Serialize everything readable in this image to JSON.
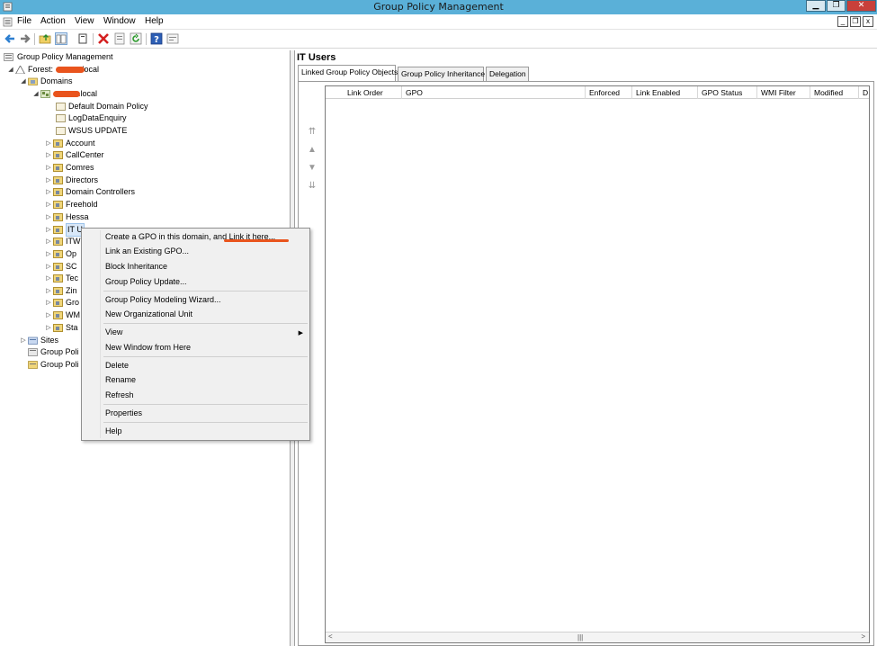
{
  "window": {
    "title": "Group Policy Management",
    "min_label": "▁",
    "max_label": "❐",
    "close_label": "✕"
  },
  "menubar": {
    "items": [
      "File",
      "Action",
      "View",
      "Window",
      "Help"
    ],
    "mdi_min": "_",
    "mdi_restore": "❐",
    "mdi_close": "x"
  },
  "toolbar": {
    "icons": [
      "back-arrow-icon",
      "forward-arrow-icon",
      "folder-up-icon",
      "show-hide-console-tree-icon",
      "copy-icon",
      "delete-icon",
      "properties-icon",
      "refresh-icon",
      "help-icon",
      "export-list-icon"
    ]
  },
  "tree": {
    "root": "Group Policy Management",
    "forest_prefix": "Forest: ",
    "forest_suffix": "local",
    "domains": "Domains",
    "domain_suffix": ".local",
    "gpo_links": [
      "Default Domain Policy",
      "LogDataEnquiry",
      "WSUS UPDATE"
    ],
    "ous": [
      "Account",
      "CallCenter",
      "Comres",
      "Directors",
      "Domain Controllers",
      "Freehold",
      "Hessa",
      "IT U",
      "ITW",
      "Op",
      "SC",
      "Tec",
      "Zin",
      "Gro",
      "WM",
      "Sta"
    ],
    "sites": "Sites",
    "group_policy_a": "Group Poli",
    "group_policy_b": "Group Poli"
  },
  "right": {
    "title": "IT Users",
    "tabs": [
      "Linked Group Policy Objects",
      "Group Policy Inheritance",
      "Delegation"
    ],
    "columns": [
      "Link Order",
      "GPO",
      "Enforced",
      "Link Enabled",
      "GPO Status",
      "WMI Filter",
      "Modified",
      "D"
    ],
    "arrows": [
      "⇈",
      "▲",
      "▼",
      "⇊"
    ],
    "scroll_left": "<",
    "scroll_right": ">",
    "scroll_thumb": "|||"
  },
  "context_menu": {
    "items": [
      "Create a GPO in this domain, and Link it here...",
      "Link an Existing GPO...",
      "Block Inheritance",
      "Group Policy Update...",
      "Group Policy Modeling Wizard...",
      "New Organizational Unit",
      "View",
      "New Window from Here",
      "Delete",
      "Rename",
      "Refresh",
      "Properties",
      "Help"
    ],
    "submenu_arrow": "▶"
  },
  "colors": {
    "titlebar": "#5ab0d8",
    "close_button": "#c8403a",
    "redaction": "#e9541d",
    "selection": "#d9e8f8"
  }
}
